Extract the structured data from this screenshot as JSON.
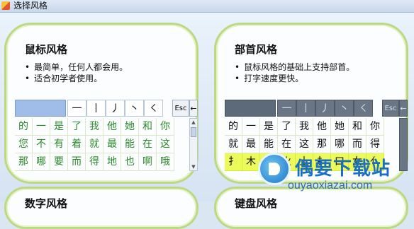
{
  "window": {
    "title": "选择风格"
  },
  "cards": [
    {
      "title": "鼠标风格",
      "desc": [
        "最简单，任何人都会用。",
        "适合初学者使用。"
      ],
      "keyboard": {
        "strokes": [
          "一",
          "丨",
          "丿",
          "丶",
          "㇛"
        ],
        "esc": "Esc",
        "back": "←",
        "chars": [
          "的",
          "一",
          "是",
          "了",
          "我",
          "他",
          "她",
          "和",
          "你",
          "您",
          "不",
          "有",
          "着",
          "就",
          "最",
          "能",
          "在",
          "这",
          "那",
          "哪",
          "要",
          "而",
          "得",
          "地",
          "也",
          "啊",
          "哦"
        ],
        "scroll_up": "▲",
        "scroll_down": "▼"
      }
    },
    {
      "title": "部首风格",
      "desc": [
        "鼠标风格的基础上支持部首。",
        "打字速度更快。"
      ],
      "keyboard": {
        "strokes": [
          "一",
          "丨",
          "丿",
          "丶",
          "㇛"
        ],
        "esc": "Esc",
        "back": "←",
        "chars": [
          "的",
          "一",
          "是",
          "了",
          "我",
          "他",
          "她",
          "和",
          "你",
          "就",
          "最",
          "能",
          "在",
          "这",
          "那",
          "哪",
          "而",
          "得",
          "扌",
          "木",
          "氵",
          "火",
          "土",
          "扌",
          "口",
          "女",
          "亻"
        ],
        "radical_row_color": "#ecfb5a"
      }
    },
    {
      "title": "数字风格"
    },
    {
      "title": "键盘风格"
    }
  ],
  "watermark": {
    "name": "偶要下载站",
    "url": "ouyaoxiazai.com",
    "color": "#1a6fc4"
  }
}
